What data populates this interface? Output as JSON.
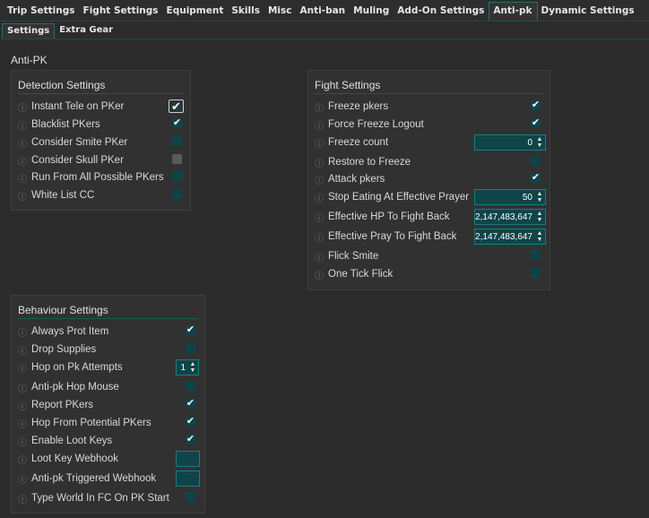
{
  "top_tabs": [
    "Trip Settings",
    "Fight Settings",
    "Equipment",
    "Skills",
    "Misc",
    "Anti-ban",
    "Muling",
    "Add-On Settings",
    "Anti-pk",
    "Dynamic Settings"
  ],
  "active_top_tab": "Anti-pk",
  "sub_tabs": [
    "Settings",
    "Extra Gear"
  ],
  "active_sub_tab": "Settings",
  "section_title": "Anti-PK",
  "info_icon": "ⓘ",
  "detection": {
    "title": "Detection Settings",
    "rows": [
      {
        "label": "Instant Tele on PKer",
        "checked": true
      },
      {
        "label": "Blacklist PKers",
        "checked": true
      },
      {
        "label": "Consider Smite PKer",
        "checked": false
      },
      {
        "label": "Consider Skull PKer",
        "checked": false
      },
      {
        "label": "Run From All Possible PKers",
        "checked": false
      },
      {
        "label": "White List CC",
        "checked": false
      }
    ]
  },
  "fight": {
    "title": "Fight Settings",
    "rows": [
      {
        "label": "Freeze pkers",
        "checked": true
      },
      {
        "label": "Force Freeze Logout",
        "checked": true
      },
      {
        "label": "Freeze count",
        "value": "0"
      },
      {
        "label": "Restore to Freeze",
        "checked": false
      },
      {
        "label": "Attack pkers",
        "checked": true
      },
      {
        "label": "Stop Eating At Effective Prayer",
        "value": "50"
      },
      {
        "label": "Effective HP To Fight Back",
        "value": "2,147,483,647"
      },
      {
        "label": "Effective Pray To Fight Back",
        "value": "2,147,483,647"
      },
      {
        "label": "Flick Smite",
        "checked": false
      },
      {
        "label": "One Tick Flick",
        "checked": false
      }
    ]
  },
  "behaviour": {
    "title": "Behaviour Settings",
    "rows": [
      {
        "label": "Always Prot Item",
        "checked": true
      },
      {
        "label": "Drop Supplies",
        "checked": false
      },
      {
        "label": "Hop on Pk Attempts",
        "value": "1"
      },
      {
        "label": "Anti-pk Hop Mouse",
        "checked": false
      },
      {
        "label": "Report PKers",
        "checked": true
      },
      {
        "label": "Hop From Potential PKers",
        "checked": true
      },
      {
        "label": "Enable Loot Keys",
        "checked": true
      },
      {
        "label": "Loot Key Webhook",
        "value": ""
      },
      {
        "label": "Anti-pk Triggered Webhook",
        "value": ""
      },
      {
        "label": "Type World In FC On PK Start",
        "checked": false
      }
    ]
  },
  "check_glyph": "✔",
  "spin_up": "▲",
  "spin_down": "▼"
}
